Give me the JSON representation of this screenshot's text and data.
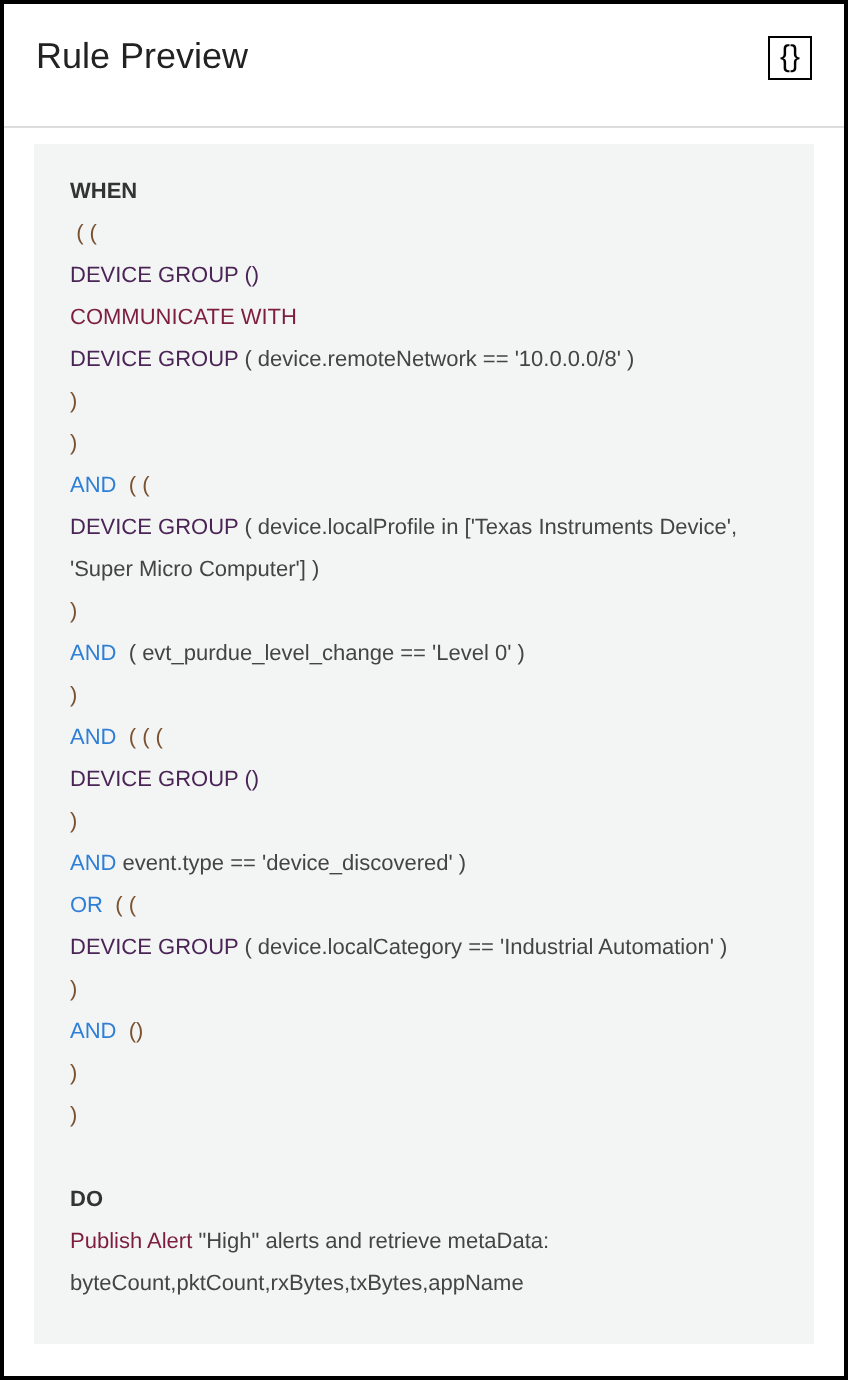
{
  "header": {
    "title": "Rule Preview",
    "toggle_label": "{}"
  },
  "when": {
    "heading": "WHEN",
    "lines": [
      [
        {
          "kind": "paren",
          "text": " ( ("
        }
      ],
      [
        {
          "kind": "entity",
          "text": "DEVICE GROUP ()"
        }
      ],
      [
        {
          "kind": "action",
          "text": "COMMUNICATE WITH"
        }
      ],
      [
        {
          "kind": "entity",
          "text": "DEVICE GROUP"
        },
        {
          "kind": "text",
          "text": " ( device.remoteNetwork == '10.0.0.0/8' )"
        }
      ],
      [
        {
          "kind": "paren",
          "text": ")"
        }
      ],
      [
        {
          "kind": "paren",
          "text": ")"
        }
      ],
      [
        {
          "kind": "operator",
          "text": "AND"
        },
        {
          "kind": "paren",
          "text": "  ( ("
        }
      ],
      [
        {
          "kind": "entity",
          "text": "DEVICE GROUP"
        },
        {
          "kind": "text",
          "text": " ( device.localProfile in ['Texas Instruments Device', 'Super Micro Computer'] )"
        }
      ],
      [
        {
          "kind": "paren",
          "text": ")"
        }
      ],
      [
        {
          "kind": "operator",
          "text": "AND"
        },
        {
          "kind": "text",
          "text": "  ( evt_purdue_level_change == 'Level 0' )"
        }
      ],
      [
        {
          "kind": "paren",
          "text": ")"
        }
      ],
      [
        {
          "kind": "operator",
          "text": "AND"
        },
        {
          "kind": "paren",
          "text": "  ( ( ("
        }
      ],
      [
        {
          "kind": "entity",
          "text": "DEVICE GROUP ()"
        }
      ],
      [
        {
          "kind": "paren",
          "text": ")"
        }
      ],
      [
        {
          "kind": "operator",
          "text": "AND"
        },
        {
          "kind": "text",
          "text": " event.type == 'device_discovered' )"
        }
      ],
      [
        {
          "kind": "operator",
          "text": "OR"
        },
        {
          "kind": "paren",
          "text": "  ( ("
        }
      ],
      [
        {
          "kind": "entity",
          "text": "DEVICE GROUP"
        },
        {
          "kind": "text",
          "text": " ( device.localCategory == 'Industrial Automation' )"
        }
      ],
      [
        {
          "kind": "paren",
          "text": ")"
        }
      ],
      [
        {
          "kind": "operator",
          "text": "AND"
        },
        {
          "kind": "paren",
          "text": "  ()"
        }
      ],
      [
        {
          "kind": "paren",
          "text": ")"
        }
      ],
      [
        {
          "kind": "paren",
          "text": ")"
        }
      ]
    ]
  },
  "do": {
    "heading": "DO",
    "lines": [
      [
        {
          "kind": "action",
          "text": "Publish Alert"
        },
        {
          "kind": "text",
          "text": " \"High\" alerts and retrieve metaData:"
        }
      ],
      [
        {
          "kind": "text",
          "text": "byteCount,pktCount,rxBytes,txBytes,appName"
        }
      ]
    ]
  }
}
